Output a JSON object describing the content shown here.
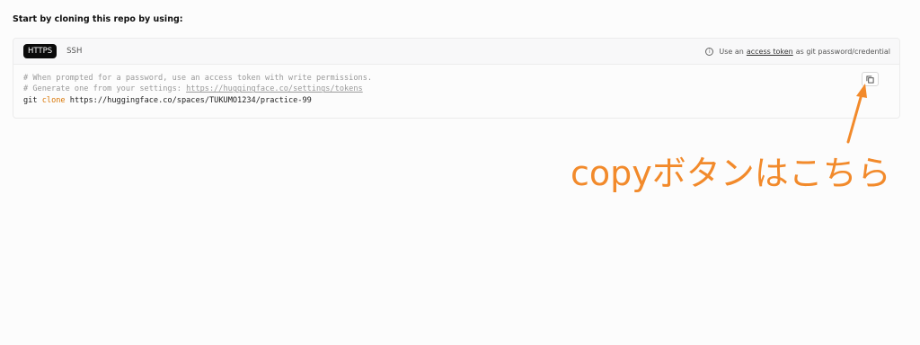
{
  "heading": "Start by cloning this repo by using:",
  "tabs": [
    {
      "label": "HTTPS",
      "active": true
    },
    {
      "label": "SSH",
      "active": false
    }
  ],
  "hint": {
    "prefix": "Use an",
    "link": "access token",
    "suffix": "as git password/credential"
  },
  "code": {
    "comment1": "# When prompted for a password, use an access token with write permissions.",
    "comment2_prefix": "# Generate one from your settings: ",
    "comment2_link": "https://huggingface.co/settings/tokens",
    "cmd_git": "git",
    "cmd_clone": "clone",
    "cmd_url": "https://huggingface.co/spaces/TUKUMO1234/practice-99"
  },
  "copy_button": {
    "icon": "copy-icon"
  },
  "annotation": {
    "text": "copyボタンはこちら",
    "color": "#f28a2b"
  }
}
